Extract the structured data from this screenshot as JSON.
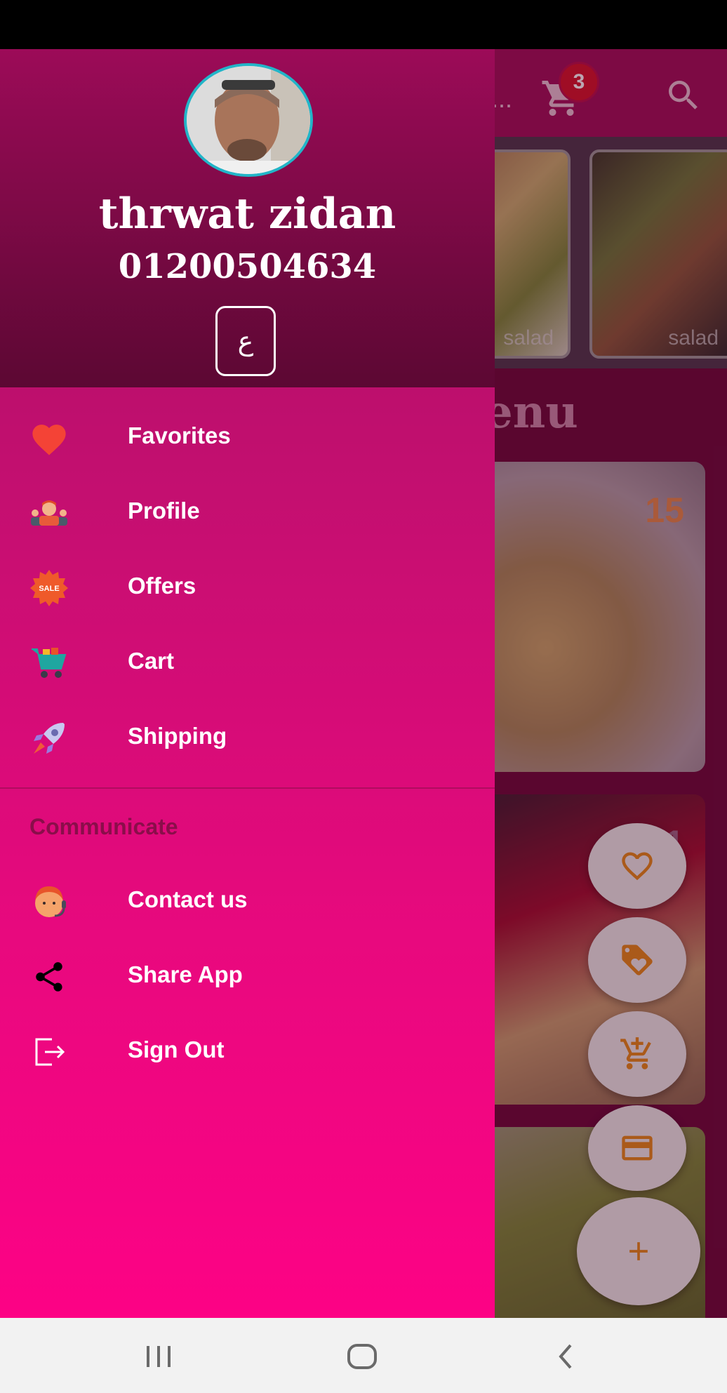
{
  "app": {
    "cart_badge": "3",
    "appbar_overflow": "...",
    "thumb_label": "salad",
    "menu_title": "enu",
    "price_1": "15",
    "price_2": "11"
  },
  "drawer": {
    "user_name": "thrwat zidan",
    "user_phone": "01200504634",
    "language_button": "ع",
    "items": [
      {
        "label": "Favorites",
        "icon": "heart-icon"
      },
      {
        "label": "Profile",
        "icon": "profile-icon"
      },
      {
        "label": "Offers",
        "icon": "sale-icon"
      },
      {
        "label": "Cart",
        "icon": "cart-icon"
      },
      {
        "label": "Shipping",
        "icon": "rocket-icon"
      }
    ],
    "section_title": "Communicate",
    "communicate_items": [
      {
        "label": "Contact us",
        "icon": "support-agent-icon"
      },
      {
        "label": "Share App",
        "icon": "share-icon"
      },
      {
        "label": "Sign Out",
        "icon": "sign-out-icon"
      }
    ],
    "offers_icon_text": "SALE"
  },
  "colors": {
    "drawer_top": "#a60e62",
    "drawer_bottom": "#fd0285",
    "header_dark": "#5c0833",
    "fab_icon": "#e58a1a"
  }
}
